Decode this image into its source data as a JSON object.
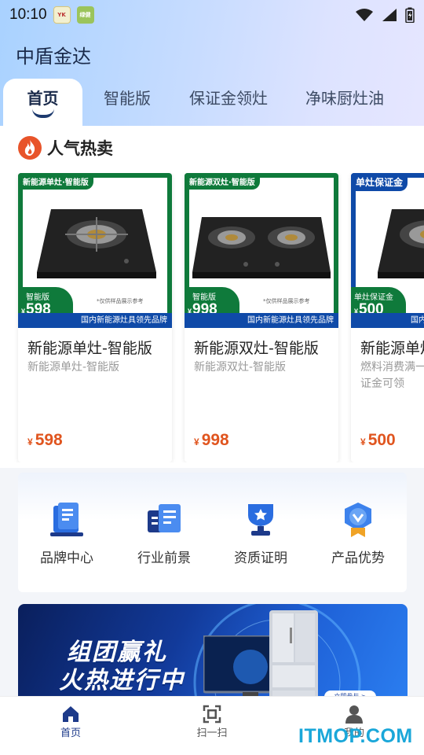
{
  "status_bar": {
    "time": "10:10",
    "app_icons": [
      {
        "text": "YK",
        "name": "app-icon"
      },
      {
        "text": "绿健",
        "name": "app-icon"
      }
    ],
    "icons": [
      "wifi-icon",
      "cellular-icon",
      "battery-icon"
    ]
  },
  "app": {
    "title": "中盾金达"
  },
  "tabs": [
    {
      "label": "首页",
      "active": true
    },
    {
      "label": "智能版",
      "active": false
    },
    {
      "label": "保证金领灶",
      "active": false
    },
    {
      "label": "净味厨灶油",
      "active": false
    }
  ],
  "hot_section": {
    "title": "人气热卖",
    "icon": "fire-icon"
  },
  "products": [
    {
      "title": "新能源单灶-智能版",
      "subtitle": "新能源单灶-智能版",
      "currency": "¥",
      "price": "598",
      "image": {
        "tag": "新能源单灶·智能版",
        "price_label": "智能版",
        "price": "598",
        "note": "*仅供样品展示参考",
        "banner": "国内新能源灶具领先品牌",
        "burners": 1
      }
    },
    {
      "title": "新能源双灶-智能版",
      "subtitle": "新能源双灶-智能版",
      "currency": "¥",
      "price": "998",
      "image": {
        "tag": "新能源双灶·智能版",
        "price_label": "智能版",
        "price": "998",
        "note": "*仅供样品展示参考",
        "banner": "国内新能源灶具领先品牌",
        "burners": 2
      }
    },
    {
      "title": "新能源单灶-保证金",
      "subtitle": "燃料消费满一定量返还约保证金可领",
      "currency": "¥",
      "price": "500",
      "image": {
        "tag": "单灶保证金",
        "price_label": "单灶保证金",
        "price": "500",
        "note": "",
        "banner": "国内新能源灶具领先品牌",
        "burners": 1
      }
    }
  ],
  "features": [
    {
      "label": "品牌中心",
      "icon": "brand-book-icon"
    },
    {
      "label": "行业前景",
      "icon": "industry-news-icon"
    },
    {
      "label": "资质证明",
      "icon": "certificate-trophy-icon"
    },
    {
      "label": "产品优势",
      "icon": "advantage-medal-icon"
    }
  ],
  "promo": {
    "line1": "组团赢礼",
    "line2": "火热进行中",
    "button": "立即参与 >"
  },
  "bottom_nav": [
    {
      "label": "首页",
      "icon": "home-icon",
      "active": true
    },
    {
      "label": "扫一扫",
      "icon": "scan-icon",
      "active": false
    },
    {
      "label": "我的",
      "icon": "user-icon",
      "active": false
    }
  ],
  "watermark": "ITMOP.COM",
  "colors": {
    "accent": "#1d3a8a",
    "price": "#e0551f",
    "product_green": "#0f7a3b",
    "product_blue": "#0f4aa8"
  }
}
